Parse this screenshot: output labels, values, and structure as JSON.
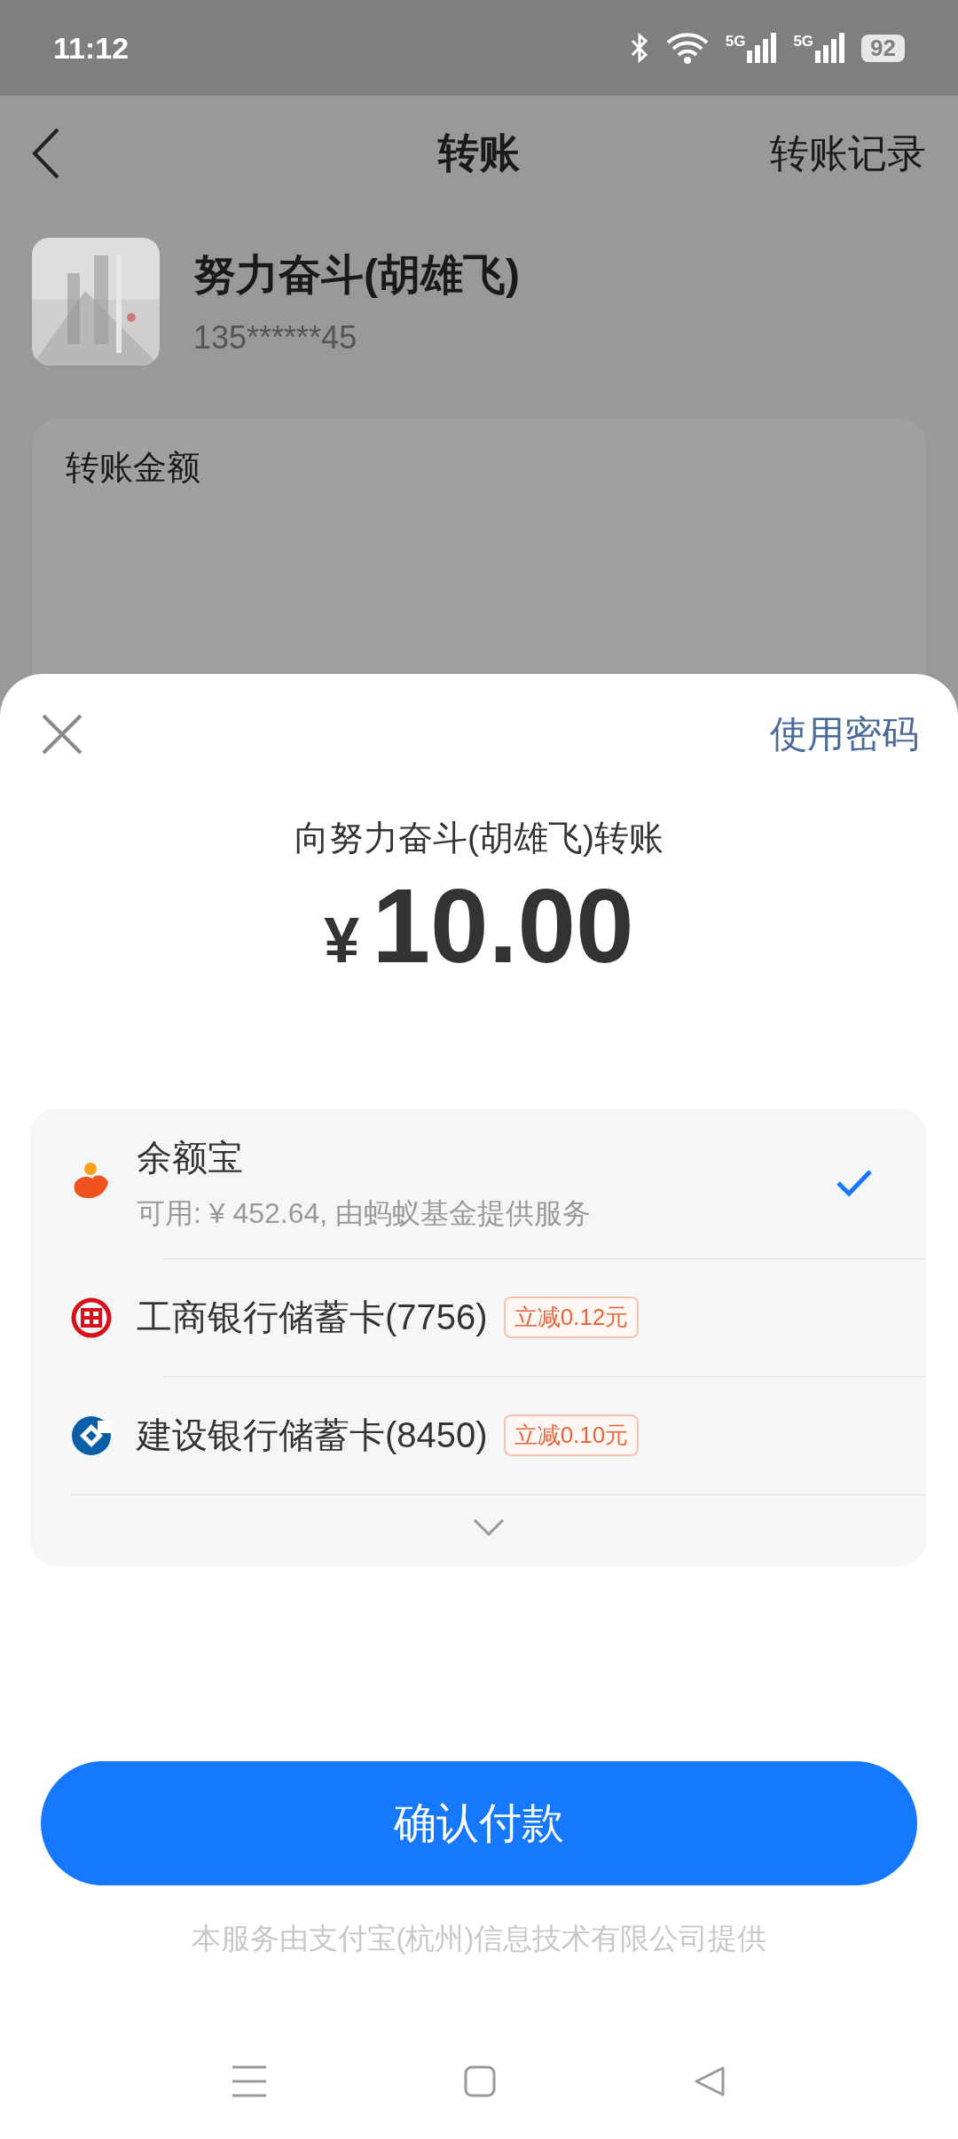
{
  "status_bar": {
    "time": "11:12",
    "networks": [
      "5G",
      "5G"
    ],
    "battery": "92"
  },
  "header": {
    "title": "转账",
    "action": "转账记录"
  },
  "recipient": {
    "name": "努力奋斗(胡雄飞)",
    "phone": "135******45"
  },
  "amount_card": {
    "label": "转账金额"
  },
  "sheet": {
    "action": "使用密码",
    "title": "向努力奋斗(胡雄飞)转账",
    "currency": "¥",
    "amount": "10.00",
    "methods": [
      {
        "kind": "fund",
        "name": "余额宝",
        "detail": "可用: ¥ 452.64, 由蚂蚁基金提供服务",
        "selected": true
      },
      {
        "kind": "icbc",
        "name": "工商银行储蓄卡(7756)",
        "promo": "立减0.12元",
        "selected": false
      },
      {
        "kind": "ccb",
        "name": "建设银行储蓄卡(8450)",
        "promo": "立减0.10元",
        "selected": false
      }
    ],
    "confirm": "确认付款",
    "footer": "本服务由支付宝(杭州)信息技术有限公司提供"
  }
}
